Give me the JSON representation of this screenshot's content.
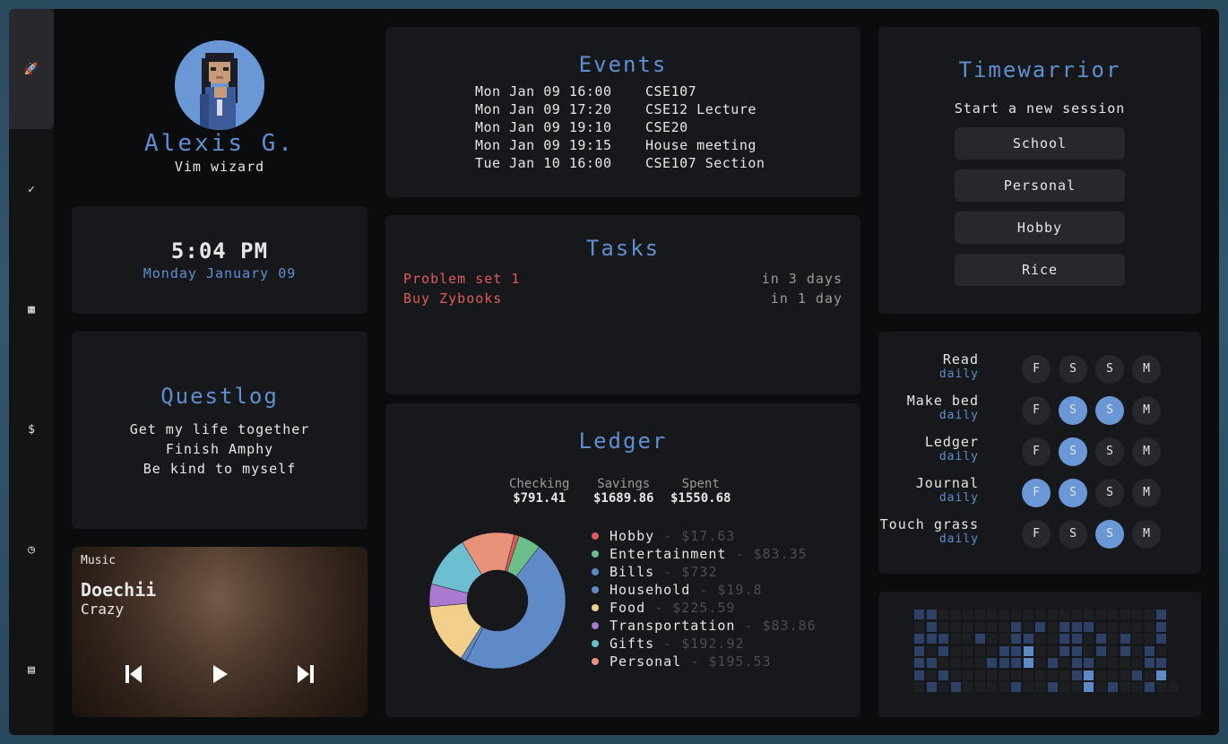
{
  "sidebar": {
    "items": [
      {
        "icon": "rocket-icon",
        "glyph": "🚀",
        "active": true
      },
      {
        "icon": "check-circle-icon",
        "glyph": "✓"
      },
      {
        "icon": "calendar-icon",
        "glyph": "▦"
      },
      {
        "icon": "dollar-icon",
        "glyph": "$"
      },
      {
        "icon": "clock-icon",
        "glyph": "◷"
      },
      {
        "icon": "notebook-icon",
        "glyph": "▤"
      }
    ]
  },
  "profile": {
    "name": "Alexis G.",
    "subtitle": "Vim wizard"
  },
  "clock": {
    "time": "5:04 PM",
    "date": "Monday January 09"
  },
  "questlog": {
    "title": "Questlog",
    "items": [
      "Get my life together",
      "Finish Amphy",
      "Be kind to myself"
    ]
  },
  "music": {
    "label": "Music",
    "artist": "Doechii",
    "track": "Crazy"
  },
  "events": {
    "title": "Events",
    "rows": [
      {
        "date": "Mon Jan 09 16:00",
        "name": "CSE107"
      },
      {
        "date": "Mon Jan 09 17:20",
        "name": "CSE12 Lecture"
      },
      {
        "date": "Mon Jan 09 19:10",
        "name": "CSE20"
      },
      {
        "date": "Mon Jan 09 19:15",
        "name": "House meeting"
      },
      {
        "date": "Tue Jan 10 16:00",
        "name": "CSE107 Section"
      }
    ]
  },
  "tasks": {
    "title": "Tasks",
    "rows": [
      {
        "name": "Problem set 1",
        "due": "in 3 days"
      },
      {
        "name": "Buy Zybooks",
        "due": "in 1 day"
      }
    ]
  },
  "ledger": {
    "title": "Ledger",
    "accounts": [
      {
        "label": "Checking",
        "value": "$791.41"
      },
      {
        "label": "Savings",
        "value": "$1689.86"
      },
      {
        "label": "Spent",
        "value": "$1550.68"
      }
    ]
  },
  "chart_data": {
    "type": "pie",
    "categories": [
      "Hobby",
      "Entertainment",
      "Bills",
      "Household",
      "Food",
      "Transportation",
      "Gifts",
      "Personal"
    ],
    "amount_labels": [
      "$17.63",
      "$83.35",
      "$732",
      "$19.8",
      "$225.59",
      "$83.86",
      "$192.92",
      "$195.53"
    ],
    "values": [
      17.63,
      83.35,
      732,
      19.8,
      225.59,
      83.86,
      192.92,
      195.53
    ],
    "colors": [
      "#e05a5a",
      "#6cbf8a",
      "#5f8ac8",
      "#5f8ac8",
      "#f2cf8a",
      "#a97ad0",
      "#6cbfd0",
      "#e8927a"
    ]
  },
  "timewarrior": {
    "title": "Timewarrior",
    "subtitle": "Start a new session",
    "buttons": [
      "School",
      "Personal",
      "Hobby",
      "Rice"
    ]
  },
  "habits": {
    "days": [
      "F",
      "S",
      "S",
      "M"
    ],
    "rows": [
      {
        "name": "Read",
        "freq": "daily",
        "done": [
          false,
          false,
          false,
          false
        ]
      },
      {
        "name": "Make bed",
        "freq": "daily",
        "done": [
          false,
          true,
          true,
          false
        ]
      },
      {
        "name": "Ledger",
        "freq": "daily",
        "done": [
          false,
          true,
          false,
          false
        ]
      },
      {
        "name": "Journal",
        "freq": "daily",
        "done": [
          true,
          true,
          false,
          false
        ]
      },
      {
        "name": "Touch grass",
        "freq": "daily",
        "done": [
          false,
          false,
          true,
          false
        ]
      }
    ]
  },
  "heatmap": {
    "levels": [
      [
        2,
        2,
        1,
        1,
        1,
        1,
        1,
        1,
        1,
        1,
        1,
        1,
        1,
        1,
        1,
        1,
        1,
        1,
        1,
        1,
        2
      ],
      [
        1,
        2,
        1,
        1,
        1,
        1,
        1,
        1,
        2,
        1,
        2,
        1,
        2,
        2,
        2,
        1,
        1,
        1,
        1,
        1,
        2
      ],
      [
        2,
        2,
        2,
        1,
        1,
        2,
        1,
        1,
        2,
        2,
        1,
        1,
        2,
        2,
        1,
        2,
        1,
        2,
        1,
        1,
        2
      ],
      [
        2,
        1,
        2,
        1,
        1,
        1,
        1,
        2,
        2,
        3,
        1,
        1,
        2,
        2,
        1,
        2,
        1,
        2,
        1,
        2,
        1
      ],
      [
        2,
        2,
        1,
        1,
        1,
        1,
        2,
        2,
        2,
        3,
        1,
        2,
        1,
        2,
        2,
        1,
        1,
        1,
        1,
        2,
        2
      ],
      [
        2,
        1,
        2,
        1,
        1,
        1,
        1,
        1,
        1,
        1,
        1,
        1,
        1,
        2,
        3,
        1,
        1,
        1,
        2,
        1,
        3
      ],
      [
        1,
        2,
        1,
        2,
        1,
        1,
        1,
        1,
        2,
        1,
        1,
        2,
        1,
        1,
        3,
        1,
        2,
        1,
        1,
        2,
        1,
        1
      ]
    ]
  }
}
